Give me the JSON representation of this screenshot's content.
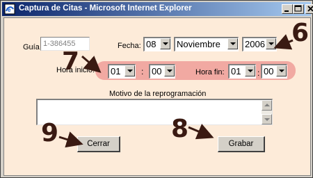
{
  "window": {
    "title": "Captura de Citas - Microsoft Internet Explorer",
    "controls": {
      "minimize": "_",
      "maximize": "□",
      "close": "×"
    }
  },
  "form": {
    "guia": {
      "label": "Guía",
      "value": "1-386455"
    },
    "fecha": {
      "label": "Fecha:",
      "day": "08",
      "month": "Noviembre",
      "year": "2006"
    },
    "hora_inicio": {
      "label": "Hora inicio:",
      "hour": "01",
      "separator": ":",
      "minute": "00"
    },
    "hora_fin": {
      "label": "Hora fin:",
      "hour": "01",
      "separator": ":",
      "minute": "00"
    },
    "motivo": {
      "label": "Motivo de la reprogramación",
      "value": ""
    },
    "buttons": {
      "cerrar": "Cerrar",
      "grabar": "Grabar"
    }
  },
  "annotations": {
    "six": "6",
    "seven": "7",
    "eight": "8",
    "nine": "9"
  },
  "colors": {
    "title_gradient_start": "#0a246a",
    "client_background": "#fdebd9",
    "time_highlight": "#f1a9a2",
    "annotation": "#3a1a12"
  }
}
